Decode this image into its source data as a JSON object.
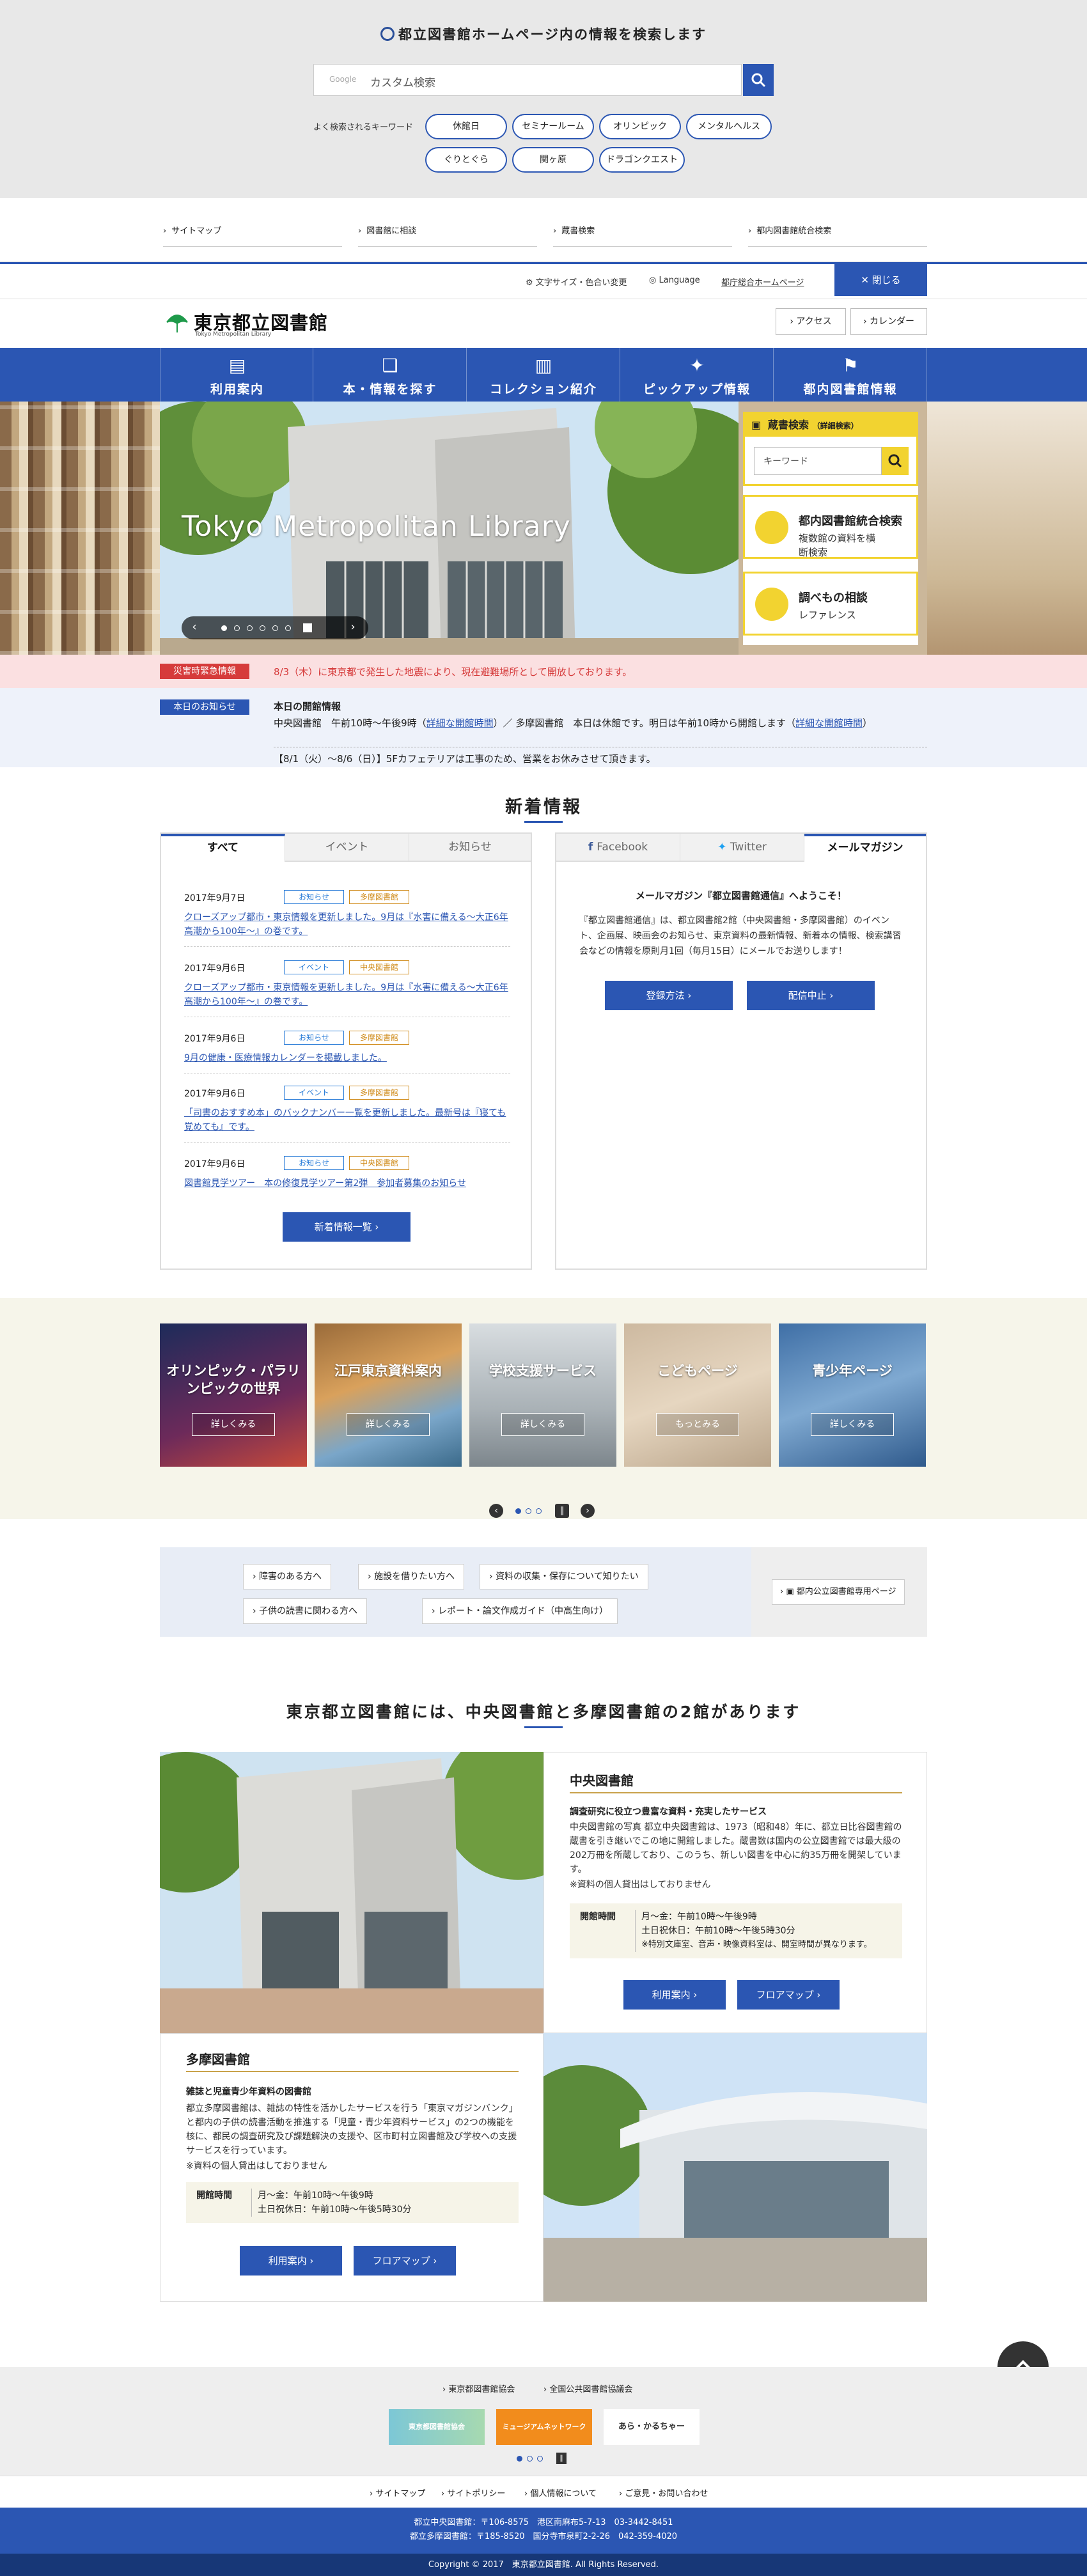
{
  "search": {
    "title": "都立図書館ホームページ内の情報を検索します",
    "google": "Google",
    "placeholder": "カスタム検索",
    "keywords_label": "よく検索されるキーワード",
    "keywords": [
      "休館日",
      "セミナールーム",
      "オリンピック",
      "メンタルヘルス",
      "ぐりとぐら",
      "関ヶ原",
      "ドラゴンクエスト"
    ]
  },
  "quick_links": [
    "サイトマップ",
    "図書館に相談",
    "蔵書検索",
    "都内図書館統合検索"
  ],
  "util": {
    "font_color": "文字サイズ・色合い変更",
    "language": "Language",
    "gov": "都庁総合ホームページ",
    "close": "閉じる"
  },
  "header": {
    "logo_title": "東京都立図書館",
    "logo_sub": "Tokyo Metropolitan Library",
    "access": "アクセス",
    "calendar": "カレンダー"
  },
  "nav": [
    "利用案内",
    "本・情報を探す",
    "コレクション紹介",
    "ピックアップ情報",
    "都内図書館情報"
  ],
  "hero": {
    "caption": "Tokyo Metropolitan Library"
  },
  "side": {
    "book_search": "蔵書検索",
    "book_search_detail": "（詳細検索）",
    "keyword_placeholder": "キーワード",
    "integrated_title": "都内図書館統合検索",
    "integrated_desc": "複数館の資料を横断検索",
    "reference_title": "調べもの相談",
    "reference_desc": "レファレンス"
  },
  "alert": {
    "label": "災害時緊急情報",
    "text": "8/3（木）に東京都で発生した地震により、現在避難場所として開放しております。"
  },
  "notice": {
    "label": "本日のお知らせ",
    "heading": "本日の開館情報",
    "line1_a": "中央図書館　午前10時〜午後9時（",
    "line1_link1": "詳細な開館時間",
    "line1_b": "）／ 多摩図書館　本日は休館です。明日は午前10時から開館します（",
    "line1_link2": "詳細な開館時間",
    "line1_c": "）",
    "line2": "【8/1（火）〜8/6（日）】5Fカフェテリアは工事のため、営業をお休みさせて頂きます。"
  },
  "news": {
    "heading": "新着情報",
    "tabs": [
      "すべて",
      "イベント",
      "お知らせ"
    ],
    "items": [
      {
        "date": "2017年9月7日",
        "tag1": "お知らせ",
        "tag2": "多摩図書館",
        "text": "クローズアップ都市・東京情報を更新しました。9月は『水害に備える〜大正6年高潮から100年〜』の巻です。"
      },
      {
        "date": "2017年9月6日",
        "tag1": "イベント",
        "tag2": "中央図書館",
        "text": "クローズアップ都市・東京情報を更新しました。9月は『水害に備える〜大正6年高潮から100年〜』の巻です。"
      },
      {
        "date": "2017年9月6日",
        "tag1": "お知らせ",
        "tag2": "多摩図書館",
        "text": "9月の健康・医療情報カレンダーを掲載しました。"
      },
      {
        "date": "2017年9月6日",
        "tag1": "イベント",
        "tag2": "多摩図書館",
        "text": "「司書のおすすめ本」のバックナンバー一覧を更新しました。最新号は『寝ても覚めても』です。"
      },
      {
        "date": "2017年9月6日",
        "tag1": "お知らせ",
        "tag2": "中央図書館",
        "text": "図書館見学ツアー　本の修復見学ツアー第2弾　参加者募集のお知らせ"
      }
    ],
    "more": "新着情報一覧"
  },
  "mail": {
    "tabs": [
      "Facebook",
      "Twitter",
      "メールマガジン"
    ],
    "title": "メールマガジン『都立図書館通信』へようこそ！",
    "body": "『都立図書館通信』は、都立図書館2館（中央図書館・多摩図書館）のイベント、企画展、映画会のお知らせ、東京資料の最新情報、新着本の情報、検索講習会などの情報を原則月1回（毎月15日）にメールでお送りします！",
    "register": "登録方法",
    "stop": "配信中止"
  },
  "banners": [
    {
      "label": "オリンピック・パラリンピックの世界",
      "more": "詳しくみる"
    },
    {
      "label": "江戸東京資料案内",
      "more": "詳しくみる"
    },
    {
      "label": "学校支援サービス",
      "more": "詳しくみる"
    },
    {
      "label": "こどもページ",
      "more": "もっとみる"
    },
    {
      "label": "青少年ページ",
      "more": "詳しくみる"
    }
  ],
  "guides": [
    "障害のある方へ",
    "施設を借りたい方へ",
    "資料の収集・保存について知りたい",
    "子供の読書に関わる方へ",
    "レポート・論文作成ガイド（中高生向け）"
  ],
  "guide_right": "都内公立図書館専用ページ",
  "libs": {
    "heading": "東京都立図書館には、中央図書館と多摩図書館の2館があります",
    "central": {
      "name": "中央図書館",
      "sub": "調査研究に役立つ豊富な資料・充実したサービス",
      "text": "中央図書館の写真 都立中央図書館は、1973（昭和48）年に、都立日比谷図書館の蔵書を引き継いでこの地に開館しました。蔵書数は国内の公立図書館では最大級の202万冊を所蔵しており、このうち、新しい図書を中心に約35万冊を開架しています。",
      "note": "※資料の個人貸出はしておりません",
      "hours_label": "開館時間",
      "hours1": "月〜金：午前10時〜午後9時",
      "hours2": "土日祝休日：午前10時〜午後5時30分",
      "hours3": "※特別文庫室、音声・映像資料室は、開室時間が異なります。",
      "btn1": "利用案内",
      "btn2": "フロアマップ"
    },
    "tama": {
      "name": "多摩図書館",
      "sub": "雑誌と児童青少年資料の図書館",
      "text": "都立多摩図書館は、雑誌の特性を活かしたサービスを行う「東京マガジンバンク」と都内の子供の読書活動を推進する「児童・青少年資料サービス」の2つの機能を核に、都民の調査研究及び課題解決の支援や、区市町村立図書館及び学校への支援サービスを行っています。",
      "note": "※資料の個人貸出はしておりません",
      "hours_label": "開館時間",
      "hours1": "月〜金：午前10時〜午後9時",
      "hours2": "土日祝休日：午前10時〜午後5時30分",
      "btn1": "利用案内",
      "btn2": "フロアマップ"
    }
  },
  "footer": {
    "assoc1": "東京都図書館協会",
    "assoc2": "全国公共図書館協議会",
    "partners": [
      "東京都図書館協会",
      "ミュージアムネットワーク",
      "あら・かるちゃー"
    ],
    "links": [
      "サイトマップ",
      "サイトポリシー",
      "個人情報について",
      "ご意見・お問い合わせ"
    ],
    "addr1": "都立中央図書館：〒106-8575　港区南麻布5-7-13　03-3442-8451",
    "addr2": "都立多摩図書館：〒185-8520　国分寺市泉町2-2-26　042-359-4020",
    "copyright": "Copyright © 2017　東京都立図書館. All Rights Reserved."
  },
  "colors": {
    "primary": "#2b56b3",
    "accent": "#f2d330",
    "alert": "#d63b3b"
  }
}
